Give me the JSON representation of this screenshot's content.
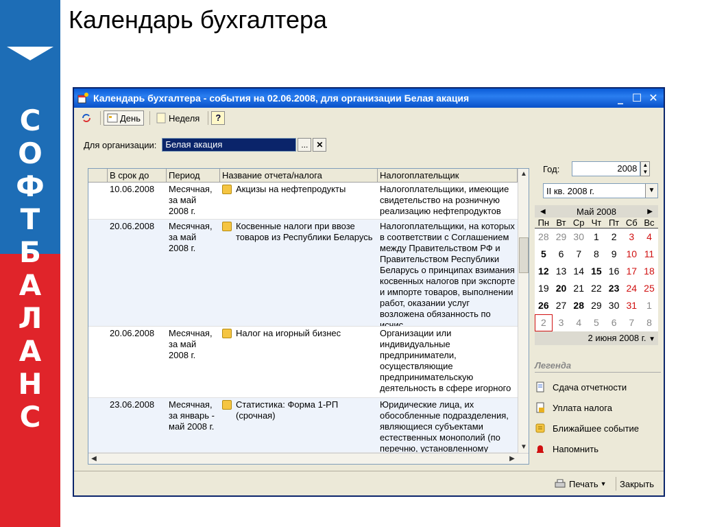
{
  "slide": {
    "title": "Календарь бухгалтера",
    "brand_letters": [
      "С",
      "О",
      "Ф",
      "Т",
      "Б",
      "А",
      "Л",
      "А",
      "Н",
      "С"
    ]
  },
  "window": {
    "title": "Календарь бухгалтера - события на 02.06.2008, для организации Белая акация",
    "controls": {
      "minimize": "_",
      "maximize": "☐",
      "close": "✕"
    }
  },
  "toolbar": {
    "day": "День",
    "week": "Неделя",
    "help": "?"
  },
  "org": {
    "label": "Для организации:",
    "value": "Белая акация",
    "select_btn": "...",
    "clear_btn": "✕"
  },
  "grid": {
    "columns": [
      "",
      "В срок до",
      "Период",
      "Название отчета/налога",
      "Налогоплательщик"
    ],
    "rows": [
      {
        "date": "10.06.2008",
        "period": "Месячная, за май 2008 г.",
        "name": "Акцизы на нефтепродукты",
        "payer": "Налогоплательщики, имеющие свидетельство на розничную реализацию нефтепродуктов"
      },
      {
        "date": "20.06.2008",
        "period": "Месячная, за май 2008 г.",
        "name": "Косвенные налоги при ввозе товаров из Республики Беларусь",
        "payer": "Налогоплательщики, на которых в соответствии с Соглашением между Правительством РФ и Правительством Республики Беларусь о принципах взимания косвенных налогов при экспорте и импорте товаров, выполнении работ, оказании услуг возложена обязанность по исчис"
      },
      {
        "date": "20.06.2008",
        "period": "Месячная, за май 2008 г.",
        "name": "Налог на игорный бизнес",
        "payer": "Организации или индивидуальные предприниматели, осуществляющие предпринимательскую деятельность в сфере игорного"
      },
      {
        "date": "23.06.2008",
        "period": "Месячная, за январь - май 2008 г.",
        "name": "Статистика: Форма 1-РП (срочная)",
        "payer": "Юридические лица, их обособленные подразделения, являющиеся субъектами естественных монополий (по перечню, установленному"
      }
    ]
  },
  "side": {
    "year_label": "Год:",
    "year": "2008",
    "quarter": "II кв. 2008 г.",
    "calendar": {
      "month": "Май 2008",
      "weekdays": [
        "Пн",
        "Вт",
        "Ср",
        "Чт",
        "Пт",
        "Сб",
        "Вс"
      ],
      "weeks": [
        [
          "28",
          "29",
          "30",
          "1",
          "2",
          "3",
          "4"
        ],
        [
          "5",
          "6",
          "7",
          "8",
          "9",
          "10",
          "11"
        ],
        [
          "12",
          "13",
          "14",
          "15",
          "16",
          "17",
          "18"
        ],
        [
          "19",
          "20",
          "21",
          "22",
          "23",
          "24",
          "25"
        ],
        [
          "26",
          "27",
          "28",
          "29",
          "30",
          "31",
          "1"
        ],
        [
          "2",
          "3",
          "4",
          "5",
          "6",
          "7",
          "8"
        ]
      ],
      "footer": "2 июня 2008 г."
    },
    "legend": {
      "title": "Легенда",
      "items": [
        "Сдача отчетности",
        "Уплата налога",
        "Ближайшее событие",
        "Напомнить"
      ]
    }
  },
  "bottom": {
    "print": "Печать",
    "close": "Закрыть"
  }
}
